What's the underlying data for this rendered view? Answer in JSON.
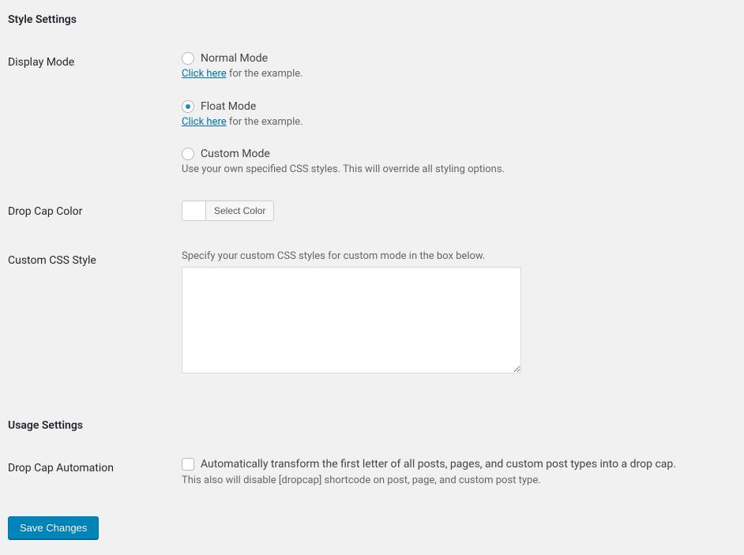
{
  "style_settings": {
    "title": "Style Settings",
    "display_mode": {
      "label": "Display Mode",
      "options": [
        {
          "label": "Normal Mode",
          "link_text": "Click here",
          "desc_suffix": " for the example.",
          "checked": false
        },
        {
          "label": "Float Mode",
          "link_text": "Click here",
          "desc_suffix": " for the example.",
          "checked": true
        },
        {
          "label": "Custom Mode",
          "desc": "Use your own specified CSS styles. This will override all styling options.",
          "checked": false
        }
      ]
    },
    "drop_cap_color": {
      "label": "Drop Cap Color",
      "button": "Select Color"
    },
    "custom_css": {
      "label": "Custom CSS Style",
      "desc": "Specify your custom CSS styles for custom mode in the box below.",
      "value": ""
    }
  },
  "usage_settings": {
    "title": "Usage Settings",
    "automation": {
      "label": "Drop Cap Automation",
      "checkbox_label": "Automatically transform the first letter of all posts, pages, and custom post types into a drop cap.",
      "desc": "This also will disable [dropcap] shortcode on post, page, and custom post type.",
      "checked": false
    }
  },
  "submit": {
    "label": "Save Changes"
  }
}
